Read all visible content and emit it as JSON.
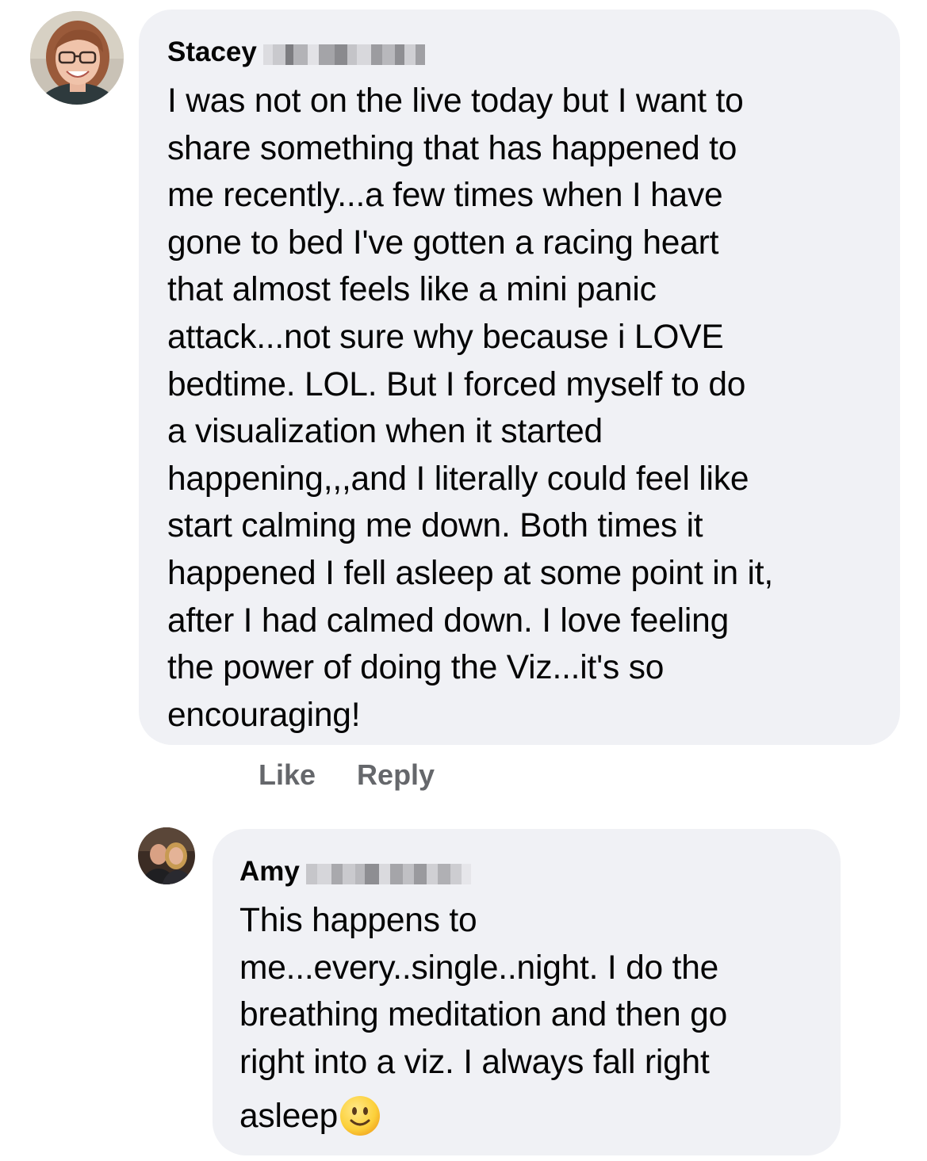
{
  "comments": [
    {
      "author": "Stacey",
      "avatar_icon": "profile-photo",
      "lines": [
        "I was not on the live today but I want to",
        "share something that has happened to",
        "me recently...a few times when I have",
        "gone to bed I've gotten a racing heart",
        "that almost feels like a mini panic",
        "attack...not sure why because i LOVE",
        "bedtime.  LOL.  But I forced myself to do",
        "a visualization when it started",
        "happening,,,and I literally could feel like",
        "start calming me down.  Both times it",
        "happened I fell asleep at some point in it,",
        "after I had calmed down.  I love feeling",
        "the power of doing the Viz...it's so",
        "encouraging!"
      ],
      "actions": {
        "like": "Like",
        "reply": "Reply"
      }
    },
    {
      "author": "Amy",
      "avatar_icon": "profile-photo",
      "lines": [
        "This happens to",
        "me...every..single..night.  I do the",
        "breathing meditation and then go",
        "right into a viz.  I always fall right",
        "asleep"
      ],
      "trailing_emoji": "slightly-smiling-face-icon"
    }
  ],
  "colors": {
    "bubble_background": "#f0f1f5",
    "action_text": "#65676b",
    "text": "#050505"
  }
}
